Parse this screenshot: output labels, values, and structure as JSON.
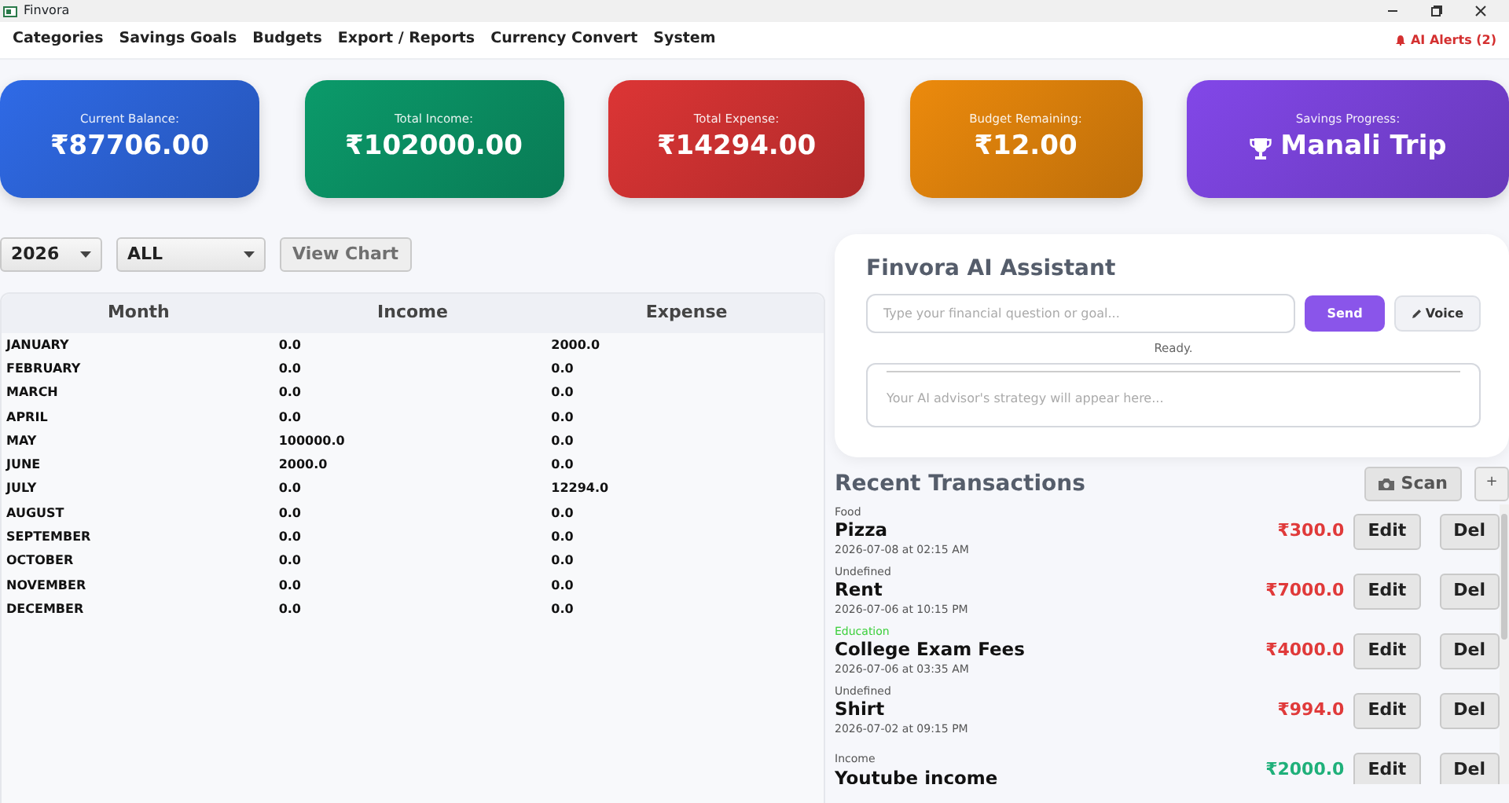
{
  "window": {
    "title": "Finvora"
  },
  "menu": [
    "Categories",
    "Savings Goals",
    "Budgets",
    "Export / Reports",
    "Currency Convert",
    "System"
  ],
  "alerts": {
    "label": "AI Alerts (2)"
  },
  "stat_cards": [
    {
      "label": "Current Balance:",
      "value": "₹87706.00",
      "color": "#2f6ae6",
      "kind": "amount"
    },
    {
      "label": "Total Income:",
      "value": "₹102000.00",
      "color": "#0b9a6a",
      "kind": "amount"
    },
    {
      "label": "Total Expense:",
      "value": "₹14294.00",
      "color": "#dc3535",
      "kind": "amount"
    },
    {
      "label": "Budget Remaining:",
      "value": "₹12.00",
      "color": "#ec8a0c",
      "kind": "amount"
    },
    {
      "label": "Savings Progress:",
      "value": "Manali Trip",
      "color": "#8247e8",
      "kind": "goal"
    }
  ],
  "filters": {
    "year": "2026",
    "category": "ALL",
    "chart_button": "View Chart"
  },
  "table": {
    "columns": [
      "Month",
      "Income",
      "Expense"
    ],
    "rows": [
      [
        "JANUARY",
        "0.0",
        "2000.0"
      ],
      [
        "FEBRUARY",
        "0.0",
        "0.0"
      ],
      [
        "MARCH",
        "0.0",
        "0.0"
      ],
      [
        "APRIL",
        "0.0",
        "0.0"
      ],
      [
        "MAY",
        "100000.0",
        "0.0"
      ],
      [
        "JUNE",
        "2000.0",
        "0.0"
      ],
      [
        "JULY",
        "0.0",
        "12294.0"
      ],
      [
        "AUGUST",
        "0.0",
        "0.0"
      ],
      [
        "SEPTEMBER",
        "0.0",
        "0.0"
      ],
      [
        "OCTOBER",
        "0.0",
        "0.0"
      ],
      [
        "NOVEMBER",
        "0.0",
        "0.0"
      ],
      [
        "DECEMBER",
        "0.0",
        "0.0"
      ]
    ]
  },
  "assistant": {
    "title": "Finvora AI Assistant",
    "placeholder": "Type your financial question or goal...",
    "send": "Send",
    "voice": "Voice",
    "status": "Ready.",
    "output_placeholder": "Your AI advisor's strategy will appear here..."
  },
  "transactions_panel": {
    "title": "Recent Transactions",
    "scan": "Scan",
    "add": "+"
  },
  "transactions": [
    {
      "category": "Food",
      "color": "#555555",
      "name": "Pizza",
      "date": "2026-07-08 at 02:15 AM",
      "amount": "₹300.0",
      "kind": "expense",
      "edit": "Edit",
      "delete": "Del"
    },
    {
      "category": "Undefined",
      "color": "#555555",
      "name": "Rent",
      "date": "2026-07-06 at 10:15 PM",
      "amount": "₹7000.0",
      "kind": "expense",
      "edit": "Edit",
      "delete": "Del"
    },
    {
      "category": "Education",
      "color": "#3ccf3c",
      "name": "College Exam Fees",
      "date": "2026-07-06 at 03:35 AM",
      "amount": "₹4000.0",
      "kind": "expense",
      "edit": "Edit",
      "delete": "Del"
    },
    {
      "category": "Undefined",
      "color": "#555555",
      "name": "Shirt",
      "date": "2026-07-02 at 09:15 PM",
      "amount": "₹994.0",
      "kind": "expense",
      "edit": "Edit",
      "delete": "Del"
    },
    {
      "category": "Income",
      "color": "#555555",
      "name": "Youtube income",
      "amount": "₹2000.0",
      "kind": "income",
      "edit": "Edit",
      "delete": "Del"
    }
  ]
}
